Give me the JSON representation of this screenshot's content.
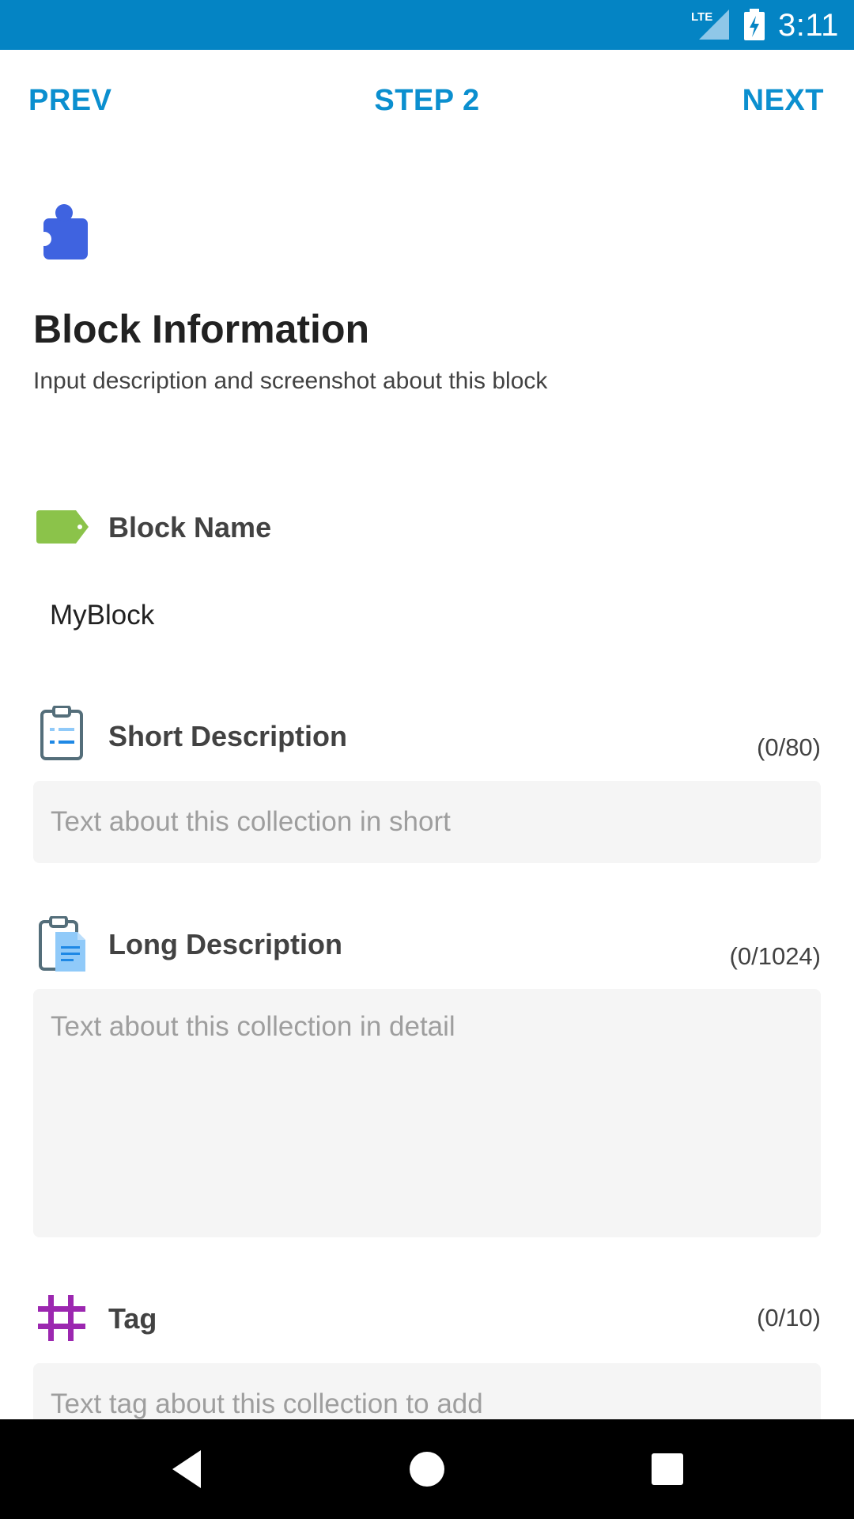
{
  "status_bar": {
    "time": "3:11",
    "network_label": "LTE",
    "icons": [
      "lte-signal-icon",
      "battery-charging-icon"
    ]
  },
  "topnav": {
    "prev_label": "PREV",
    "step_label": "STEP 2",
    "next_label": "NEXT"
  },
  "header": {
    "icon": "puzzle-piece-icon",
    "title": "Block Information",
    "subtitle": "Input description and screenshot about this block"
  },
  "block_name": {
    "icon": "tag-icon",
    "label": "Block Name",
    "value": "MyBlock"
  },
  "short_description": {
    "icon": "clipboard-list-icon",
    "label": "Short Description",
    "counter": "(0/80)",
    "value": "",
    "placeholder": "Text about this collection in short"
  },
  "long_description": {
    "icon": "clipboard-document-icon",
    "label": "Long Description",
    "counter": "(0/1024)",
    "value": "",
    "placeholder": "Text about this collection in detail"
  },
  "tag": {
    "icon": "hashtag-icon",
    "label": "Tag",
    "counter": "(0/10)",
    "value": "",
    "placeholder": "Text tag about this collection to add"
  },
  "nav_bar": {
    "buttons": [
      "back-icon",
      "home-icon",
      "recents-icon"
    ]
  },
  "colors": {
    "status_bar": "#0484c4",
    "accent": "#0b8fcf",
    "puzzle": "#3f63e0",
    "tag": "#8bc34a",
    "hashtag": "#9c27b0",
    "field_background": "#f5f5f5"
  }
}
